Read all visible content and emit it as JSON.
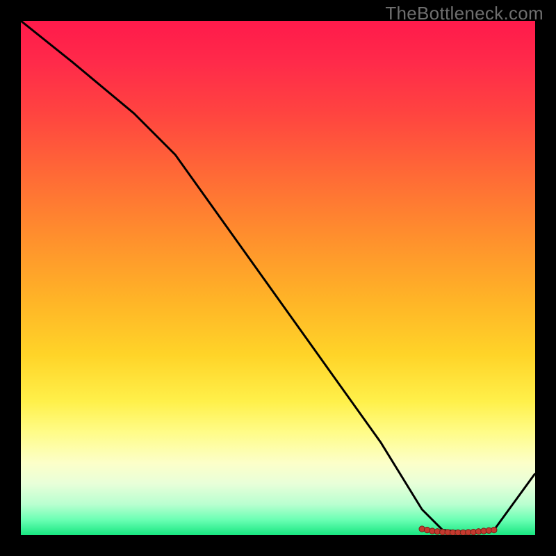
{
  "watermark": "TheBottleneck.com",
  "chart_data": {
    "type": "line",
    "title": "",
    "xlabel": "",
    "ylabel": "",
    "xlim": [
      0,
      100
    ],
    "ylim": [
      0,
      100
    ],
    "series": [
      {
        "name": "curve",
        "x": [
          0,
          10,
          22,
          30,
          40,
          50,
          60,
          70,
          78,
          82,
          88,
          92,
          100
        ],
        "values": [
          100,
          92,
          82,
          74,
          60,
          46,
          32,
          18,
          5,
          1,
          0.5,
          1,
          12
        ]
      }
    ],
    "markers": {
      "name": "highlight",
      "x": [
        78,
        79,
        80,
        81,
        82,
        83,
        84,
        85,
        86,
        87,
        88,
        89,
        90,
        91,
        92
      ],
      "values": [
        1.2,
        1.0,
        0.8,
        0.7,
        0.6,
        0.55,
        0.5,
        0.5,
        0.5,
        0.55,
        0.6,
        0.7,
        0.8,
        0.9,
        1.0
      ]
    },
    "gradient_stops": [
      {
        "pos": 0,
        "color": "#ff1a4b"
      },
      {
        "pos": 8,
        "color": "#ff2a4a"
      },
      {
        "pos": 18,
        "color": "#ff4440"
      },
      {
        "pos": 30,
        "color": "#ff6a36"
      },
      {
        "pos": 42,
        "color": "#ff8f2d"
      },
      {
        "pos": 54,
        "color": "#ffb327"
      },
      {
        "pos": 65,
        "color": "#ffd428"
      },
      {
        "pos": 74,
        "color": "#fff04a"
      },
      {
        "pos": 80,
        "color": "#fffc88"
      },
      {
        "pos": 86,
        "color": "#fcffc9"
      },
      {
        "pos": 90,
        "color": "#e8ffd9"
      },
      {
        "pos": 94,
        "color": "#b9ffd0"
      },
      {
        "pos": 97,
        "color": "#6bffb4"
      },
      {
        "pos": 100,
        "color": "#17e680"
      }
    ],
    "colors": {
      "curve": "#000000",
      "marker_fill": "#c43a2f",
      "marker_stroke": "#7a1f16",
      "frame": "#000000"
    }
  }
}
